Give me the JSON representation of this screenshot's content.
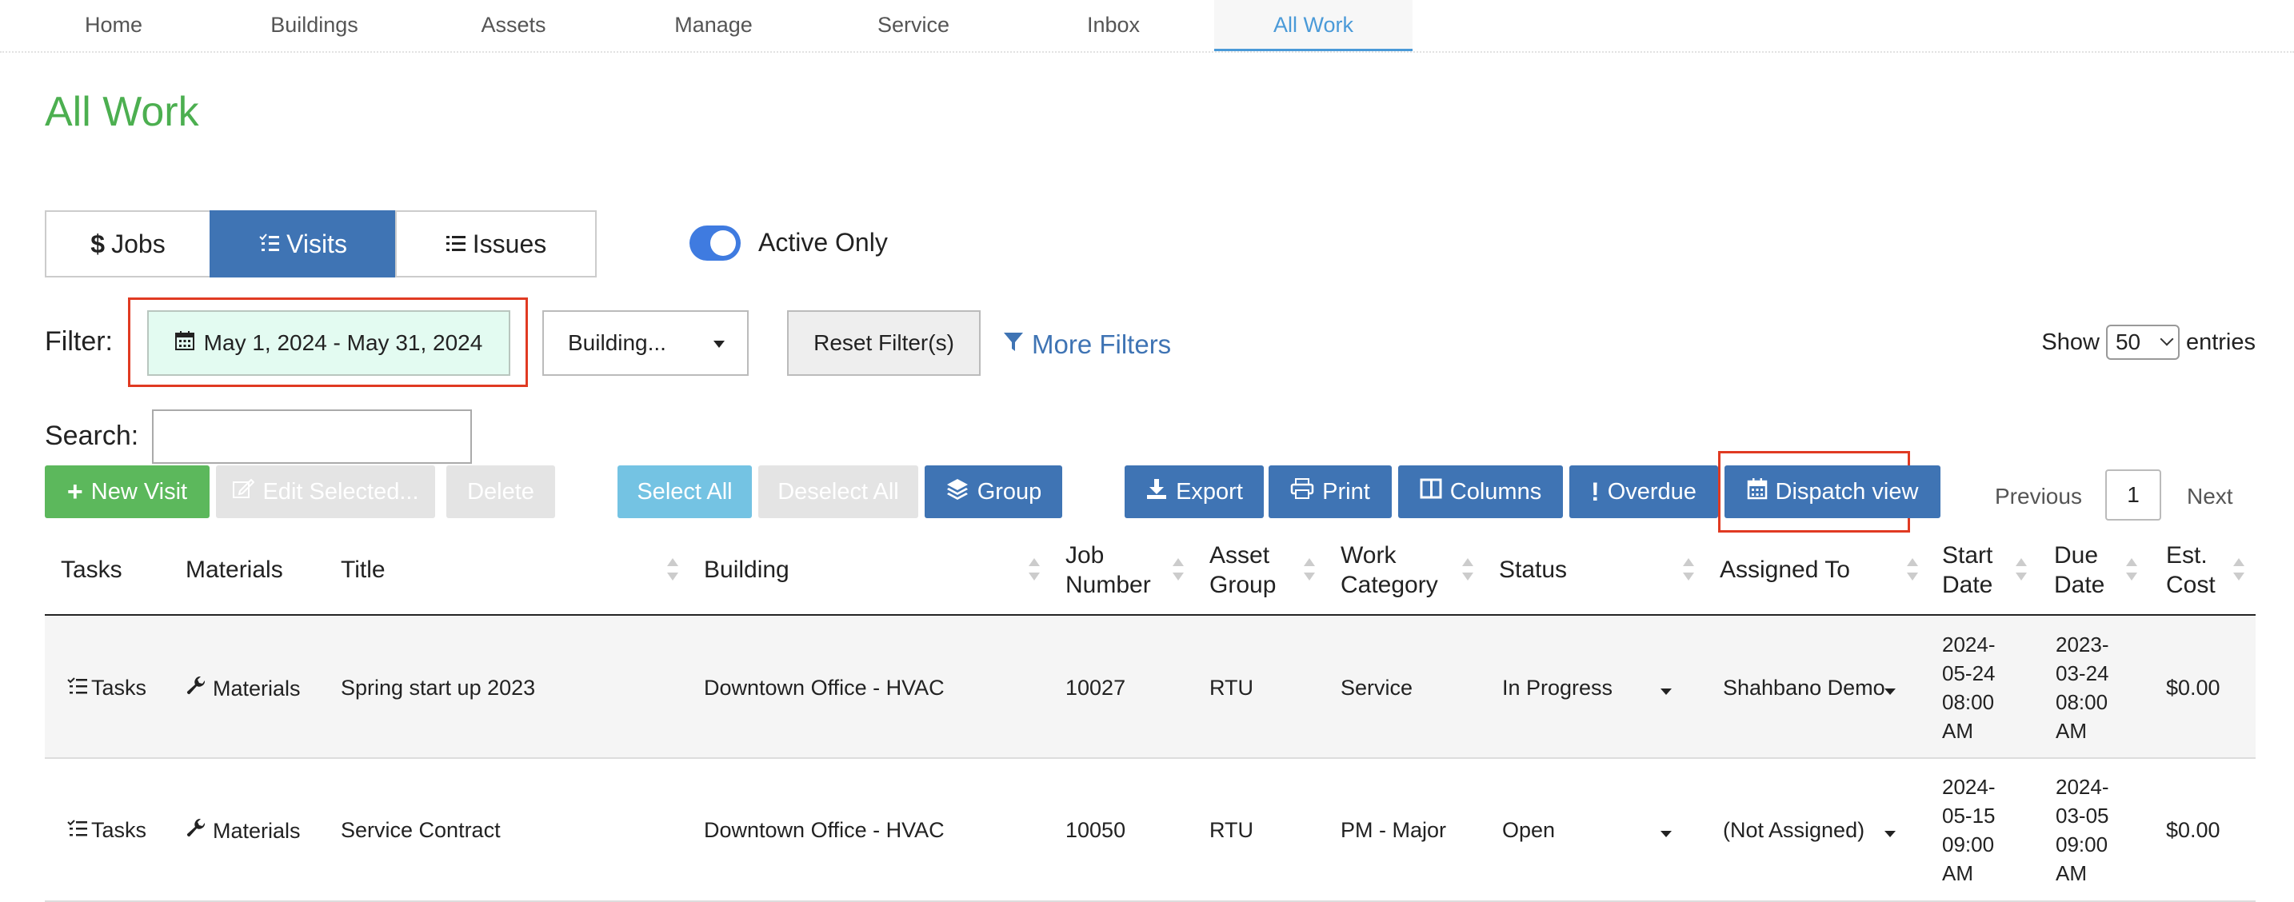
{
  "nav": {
    "items": [
      "Home",
      "Buildings",
      "Assets",
      "Manage",
      "Service",
      "Inbox",
      "All Work"
    ],
    "active": "All Work"
  },
  "page": {
    "title": "All Work"
  },
  "tabs": [
    {
      "icon": "dollar-icon",
      "label": "Jobs",
      "active": false
    },
    {
      "icon": "tasks-icon",
      "label": "Visits",
      "active": true
    },
    {
      "icon": "list-icon",
      "label": "Issues",
      "active": false
    }
  ],
  "toggle": {
    "label": "Active Only",
    "on": true
  },
  "filter": {
    "label": "Filter:",
    "date_range": "May 1, 2024 - May 31, 2024",
    "building_placeholder": "Building...",
    "reset_label": "Reset Filter(s)",
    "more_filters_label": "More Filters"
  },
  "entries": {
    "show_label": "Show",
    "value": "50",
    "suffix": "entries"
  },
  "search": {
    "label": "Search:",
    "value": ""
  },
  "toolbar": {
    "new_visit": "New Visit",
    "edit_selected": "Edit Selected...",
    "delete": "Delete",
    "select_all": "Select All",
    "deselect_all": "Deselect All",
    "group": "Group",
    "export": "Export",
    "print": "Print",
    "columns": "Columns",
    "overdue": "Overdue",
    "dispatch_view": "Dispatch view"
  },
  "pager": {
    "previous": "Previous",
    "page": "1",
    "next": "Next"
  },
  "table": {
    "headers": {
      "tasks": "Tasks",
      "materials": "Materials",
      "title": "Title",
      "building": "Building",
      "job_number": "Job Number",
      "asset_group": "Asset Group",
      "work_category": "Work Category",
      "status": "Status",
      "assigned_to": "Assigned To",
      "start_date": "Start Date",
      "due_date": "Due Date",
      "est_cost": "Est. Cost"
    },
    "rows": [
      {
        "tasks": "Tasks",
        "materials": "Materials",
        "title": "Spring start up 2023",
        "building": "Downtown Office - HVAC",
        "job_number": "10027",
        "asset_group": "RTU",
        "work_category": "Service",
        "status": "In Progress",
        "assigned_to": "Shahbano Demo",
        "start_date": "2024-\n05-24\n08:00\nAM",
        "due_date": "2023-\n03-24\n08:00\nAM",
        "est_cost": "$0.00"
      },
      {
        "tasks": "Tasks",
        "materials": "Materials",
        "title": "Service Contract",
        "building": "Downtown Office - HVAC",
        "job_number": "10050",
        "asset_group": "RTU",
        "work_category": "PM - Major",
        "status": "Open",
        "assigned_to": "(Not Assigned)",
        "start_date": "2024-\n05-15\n09:00\nAM",
        "due_date": "2024-\n03-05\n09:00\nAM",
        "est_cost": "$0.00"
      }
    ]
  },
  "colors": {
    "accent": "#3f74b4",
    "title_green": "#4caf50",
    "highlight": "#e03a22"
  }
}
